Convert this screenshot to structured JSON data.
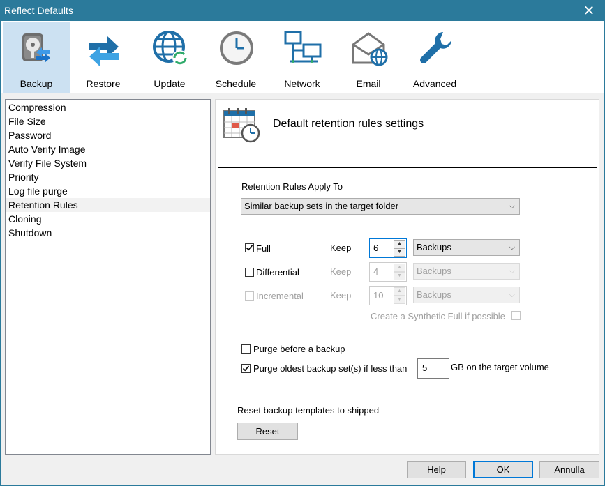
{
  "window": {
    "title": "Reflect Defaults",
    "close_glyph": "✕"
  },
  "toolbar": {
    "tabs": [
      {
        "label": "Backup",
        "icon": "backup-disk-icon"
      },
      {
        "label": "Restore",
        "icon": "restore-arrows-icon"
      },
      {
        "label": "Update",
        "icon": "update-globe-icon"
      },
      {
        "label": "Schedule",
        "icon": "schedule-clock-icon"
      },
      {
        "label": "Network",
        "icon": "network-computers-icon"
      },
      {
        "label": "Email",
        "icon": "email-envelope-icon"
      },
      {
        "label": "Advanced",
        "icon": "advanced-wrench-icon"
      }
    ],
    "active_tab": "Backup"
  },
  "sidebar": {
    "items": [
      {
        "label": "Compression"
      },
      {
        "label": "File Size"
      },
      {
        "label": "Password"
      },
      {
        "label": "Auto Verify Image"
      },
      {
        "label": "Verify File System"
      },
      {
        "label": "Priority"
      },
      {
        "label": "Log file purge"
      },
      {
        "label": "Retention Rules"
      },
      {
        "label": "Cloning"
      },
      {
        "label": "Shutdown"
      }
    ],
    "selected": "Retention Rules"
  },
  "panel": {
    "title": "Default retention rules settings",
    "icon": "calendar-clock-icon",
    "apply_to": {
      "label": "Retention Rules Apply To",
      "value": "Similar backup sets in the target folder"
    },
    "rules": {
      "full": {
        "label": "Full",
        "checked": true,
        "enabled": true,
        "keep_label": "Keep",
        "count": "6",
        "unit": "Backups"
      },
      "differential": {
        "label": "Differential",
        "checked": false,
        "enabled": true,
        "keep_label": "Keep",
        "count": "4",
        "unit": "Backups"
      },
      "incremental": {
        "label": "Incremental",
        "checked": false,
        "enabled": false,
        "keep_label": "Keep",
        "count": "10",
        "unit": "Backups"
      }
    },
    "synthetic": {
      "label": "Create a Synthetic Full if possible",
      "checked": false,
      "enabled": false
    },
    "purge_before": {
      "label": "Purge before a backup",
      "checked": false
    },
    "purge_oldest": {
      "label": "Purge oldest backup set(s) if less than",
      "checked": true,
      "value": "5",
      "suffix": "GB on the target volume"
    },
    "reset": {
      "label": "Reset backup templates to shipped",
      "button": "Reset"
    }
  },
  "footer": {
    "help": "Help",
    "ok": "OK",
    "cancel": "Annulla"
  },
  "colors": {
    "titlebar": "#2b7a9b",
    "accent": "#0078d7",
    "active_tab": "#cce1f2"
  }
}
